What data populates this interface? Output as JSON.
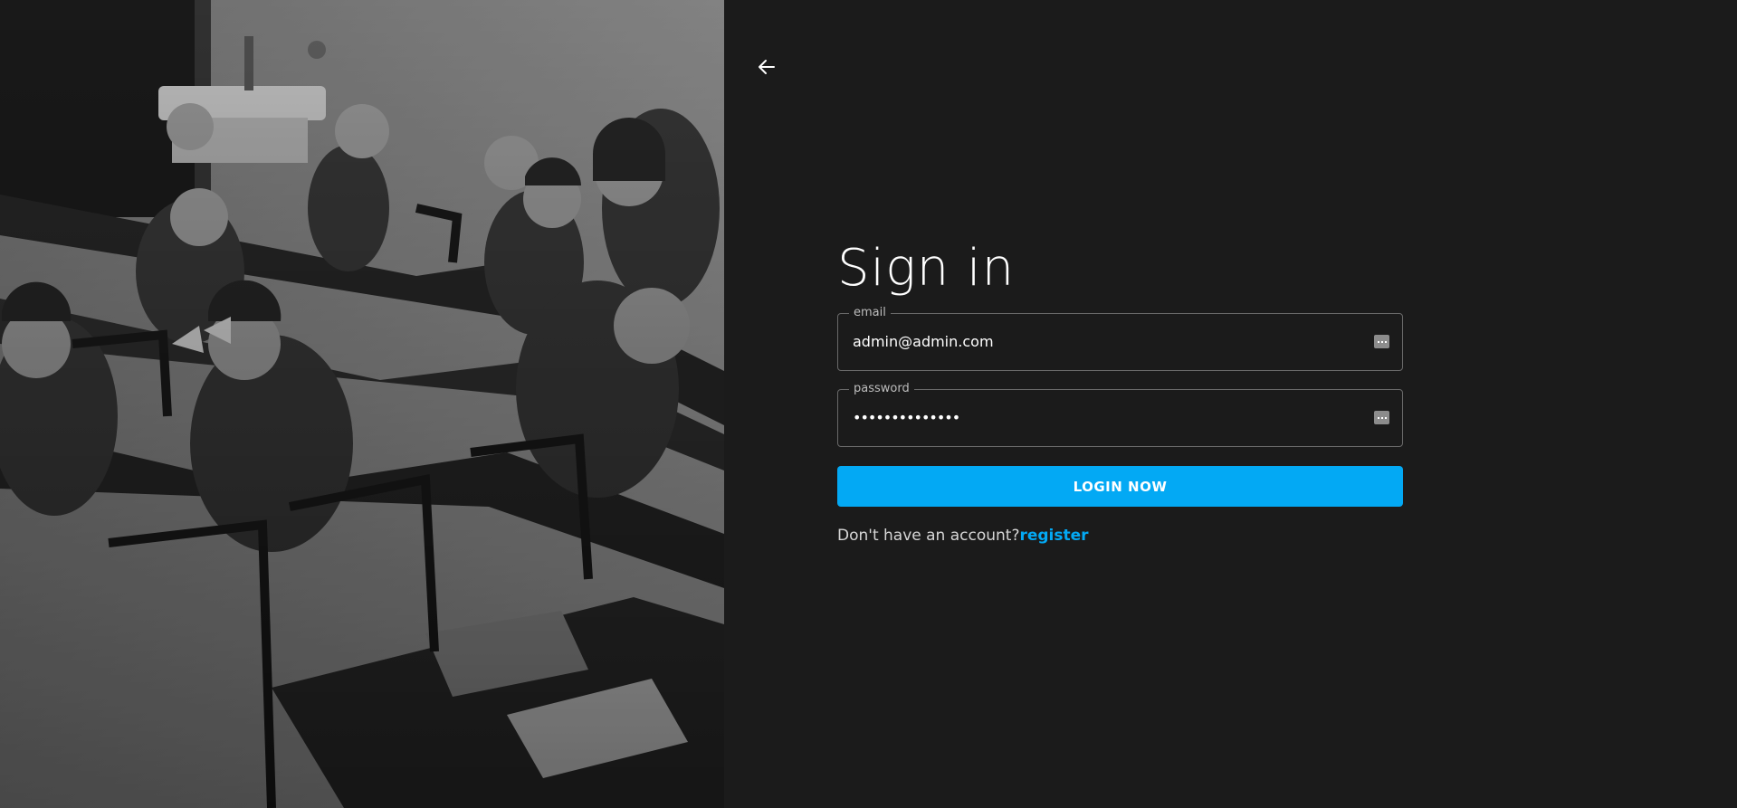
{
  "form": {
    "title": "Sign in",
    "email": {
      "label": "email",
      "value": "admin@admin.com"
    },
    "password": {
      "label": "password",
      "value": "••••••••••••••"
    },
    "login_button": "LOGIN NOW",
    "signup_prompt": "Don't have an account?",
    "register_link": "register"
  },
  "icons": {
    "back": "arrow-left-icon",
    "password_manager": "password-manager-key-icon"
  },
  "colors": {
    "background": "#1b1b1b",
    "accent": "#03a9f4",
    "text": "#ffffff"
  }
}
